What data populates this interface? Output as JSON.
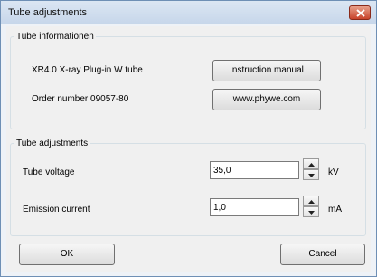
{
  "window": {
    "title": "Tube adjustments"
  },
  "tube_info": {
    "legend": "Tube informationen",
    "tube_name": "XR4.0 X-ray Plug-in W tube",
    "order_number": "Order number  09057-80",
    "manual_button": "Instruction manual",
    "website_button": "www.phywe.com"
  },
  "adjustments": {
    "legend": "Tube adjustments",
    "voltage": {
      "label": "Tube voltage",
      "value": "35,0",
      "unit": "kV"
    },
    "current": {
      "label": "Emission current",
      "value": "1,0",
      "unit": "mA"
    }
  },
  "buttons": {
    "ok": "OK",
    "cancel": "Cancel"
  }
}
